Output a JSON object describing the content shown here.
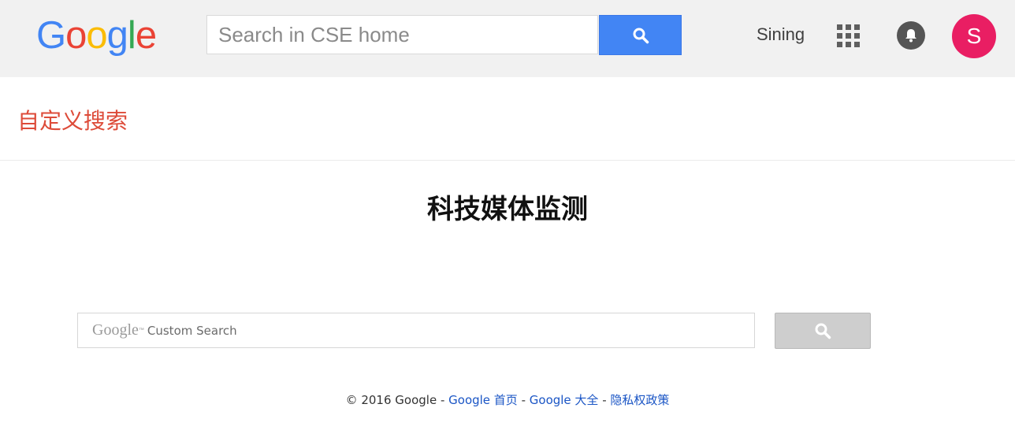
{
  "header": {
    "logo_letters": [
      {
        "char": "G",
        "color": "#4285f4"
      },
      {
        "char": "o",
        "color": "#ea4335"
      },
      {
        "char": "o",
        "color": "#fbbc05"
      },
      {
        "char": "g",
        "color": "#4285f4"
      },
      {
        "char": "l",
        "color": "#34a853"
      },
      {
        "char": "e",
        "color": "#ea4335"
      }
    ],
    "search_placeholder": "Search in CSE home",
    "search_icon": "search-icon",
    "user_name": "Sining",
    "apps_icon": "apps-grid-icon",
    "notifications_icon": "bell-icon",
    "avatar_letter": "S",
    "avatar_color": "#e91e63"
  },
  "subheader": {
    "title": "自定义搜索"
  },
  "main": {
    "engine_title": "科技媒体监测",
    "search_watermark_brand": "Google",
    "search_watermark_tm": "™",
    "search_watermark_label": "Custom Search",
    "search_button_icon": "search-icon"
  },
  "footer": {
    "copyright": "© 2016 Google",
    "separator": " - ",
    "links": [
      "Google 首页",
      "Google 大全",
      "隐私权政策"
    ]
  }
}
